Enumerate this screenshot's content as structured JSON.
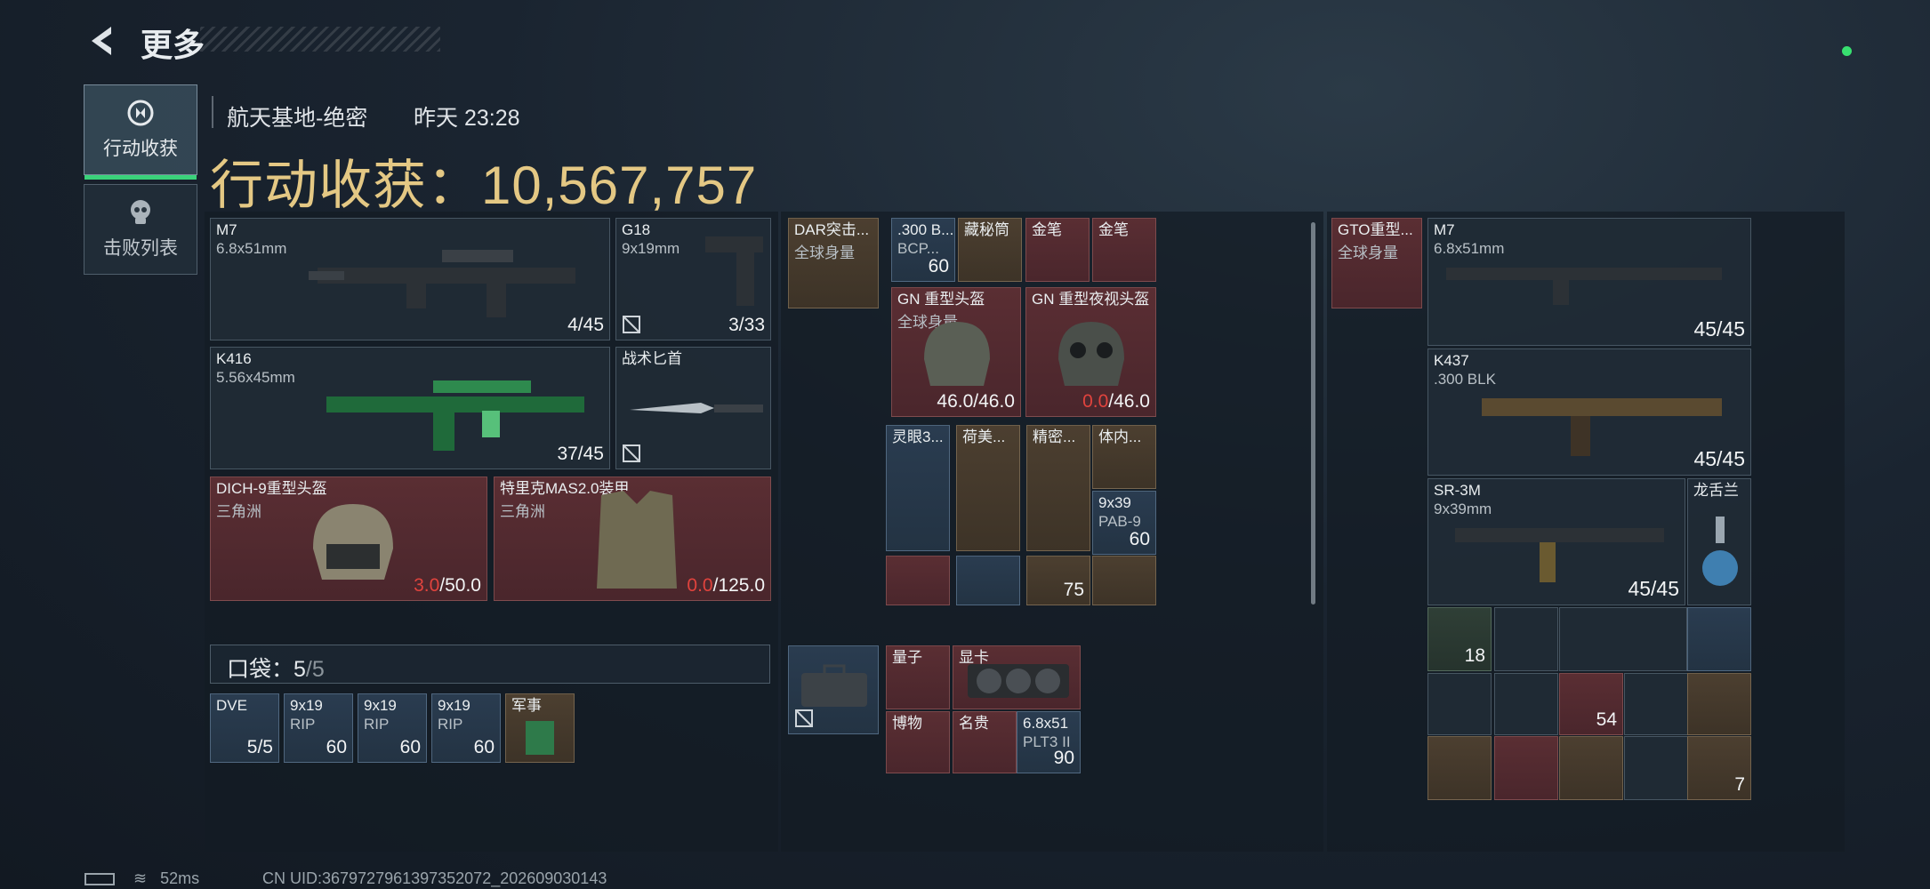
{
  "header": {
    "title": "更多",
    "back_icon": "chevron-left-icon",
    "online_color": "#38e070"
  },
  "tabs": [
    {
      "label": "行动收获",
      "icon": "loot-icon",
      "active": true
    },
    {
      "label": "击败列表",
      "icon": "skull-icon",
      "active": false
    }
  ],
  "raid": {
    "location": "航天基地-绝密",
    "time": "昨天 23:28",
    "haul_label": "行动收获：",
    "haul_value": "10,567,757",
    "accent_color": "#e4c884"
  },
  "loadout": {
    "primary": {
      "name": "M7",
      "caliber": "6.8x51mm",
      "ammo": "4/45"
    },
    "secondary": {
      "name": "G18",
      "caliber": "9x19mm",
      "ammo": "3/33"
    },
    "primary2": {
      "name": "K416",
      "caliber": "5.56x45mm",
      "ammo": "37/45"
    },
    "melee": {
      "name": "战术匕首"
    },
    "helmet": {
      "name": "DICH-9重型头盔",
      "origin": "三角洲",
      "dur_cur": "3.0",
      "dur_max": "/50.0"
    },
    "armor": {
      "name": "特里克MAS2.0装甲",
      "origin": "三角洲",
      "dur_cur": "0.0",
      "dur_max": "/125.0"
    }
  },
  "pocket": {
    "label": "口袋：",
    "count": "5",
    "sep": "/5",
    "items": [
      {
        "name": "DVE",
        "count": "5/5",
        "color": "blue"
      },
      {
        "name": "9x19",
        "sub": "RIP",
        "count": "60",
        "color": "blue"
      },
      {
        "name": "9x19",
        "sub": "RIP",
        "count": "60",
        "color": "blue"
      },
      {
        "name": "9x19",
        "sub": "RIP",
        "count": "60",
        "color": "blue"
      },
      {
        "name": "军事",
        "count": "",
        "color": "gold"
      }
    ]
  },
  "middle": {
    "chest_rig": {
      "name": "DAR突击...",
      "sub": "全球身量"
    },
    "ammo300": {
      "name": ".300 B...",
      "sub": "BCP...",
      "count": "60"
    },
    "secret": {
      "name": "藏秘筒"
    },
    "pen1": {
      "name": "金笔"
    },
    "pen2": {
      "name": "金笔"
    },
    "gn_helmet": {
      "name": "GN 重型头盔",
      "sub": "全球身量",
      "dur": "46.0/46.0"
    },
    "gn_nv": {
      "name": "GN 重型夜视头盔",
      "dur_cur": "0.0",
      "dur_max": "/46.0"
    },
    "scope": {
      "name": "灵眼3..."
    },
    "hummel": {
      "name": "荷美..."
    },
    "precise": {
      "name": "精密..."
    },
    "body": {
      "name": "体内..."
    },
    "ammo939": {
      "name": "9x39",
      "sub": "PAB-9",
      "count": "60"
    },
    "meds_count": "75",
    "case_item": {
      "name": ""
    },
    "quantum": {
      "name": "量子"
    },
    "gpu": {
      "name": "显卡"
    },
    "museum": {
      "name": "博物"
    },
    "precious": {
      "name": "名贵"
    },
    "ammo68": {
      "name": "6.8x51",
      "sub": "PLT3 II",
      "count": "90"
    }
  },
  "right": {
    "gto": {
      "name": "GTO重型...",
      "sub": "全球身量"
    },
    "m7": {
      "name": "M7",
      "caliber": "6.8x51mm",
      "ammo": "45/45"
    },
    "k437": {
      "name": "K437",
      "caliber": ".300 BLK",
      "ammo": "45/45"
    },
    "sr3m": {
      "name": "SR-3M",
      "caliber": "9x39mm",
      "ammo": "45/45"
    },
    "dragon": {
      "name": "龙舌兰"
    },
    "grid_counts": {
      "a": "18",
      "b": "54",
      "c": "7"
    }
  },
  "footer": {
    "ping": "52ms",
    "uid": "CN UID:3679727961397352072_202609030143"
  }
}
